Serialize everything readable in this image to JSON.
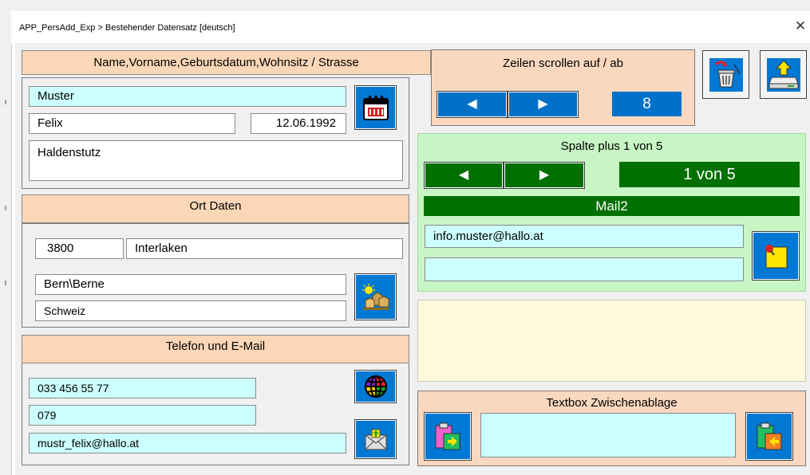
{
  "window": {
    "title": "APP_PersAdd_Exp > Bestehender Datensatz  [deutsch]",
    "close_label": "✕"
  },
  "name_section": {
    "header": "Name,Vorname,Geburtsdatum,Wohnsitz / Strasse",
    "lastname": "Muster",
    "firstname": "Felix",
    "birthdate": "12.06.1992",
    "street": "Haldenstutz",
    "calendar_icon": "calendar-icon"
  },
  "ort_section": {
    "header": "Ort Daten",
    "plz": "3800",
    "ort": "Interlaken",
    "kanton": "Bern\\Berne",
    "land": "Schweiz",
    "map_icon": "map-landscape-icon"
  },
  "contact_section": {
    "header": "Telefon und E-Mail",
    "phone": "033 456 55 77",
    "mobile": "079",
    "email": "mustr_felix@hallo.at",
    "globe_icon": "globe-icon",
    "mail_icon": "mail-upload-icon"
  },
  "scroll_section": {
    "header": "Zeilen scrollen auf / ab",
    "prev_label": "◀",
    "next_label": "▶",
    "value": "8"
  },
  "column_section": {
    "header": "Spalte plus 1 von 5",
    "prev_label": "◀",
    "next_label": "▶",
    "position": "1 von 5",
    "column_name": "Mail2",
    "value1": "info.muster@hallo.at",
    "value2": "",
    "note_icon": "sticky-note-pin-icon"
  },
  "clipboard_section": {
    "header": "Textbox Zwischenablage",
    "textbox": "",
    "paste_left_icon": "clipboard-paste-icon",
    "paste_right_icon": "clipboard-copy-icon"
  },
  "toolbar": {
    "delete_icon": "trash-delete-icon",
    "save_icon": "save-download-icon"
  },
  "colors": {
    "accent_blue": "#0070c8",
    "accent_green": "#007000",
    "header_peach": "#fbd6b7",
    "input_cyan": "#ccffff",
    "panel_green": "#c8f5c4",
    "panel_yellow": "#fdfbdc"
  }
}
